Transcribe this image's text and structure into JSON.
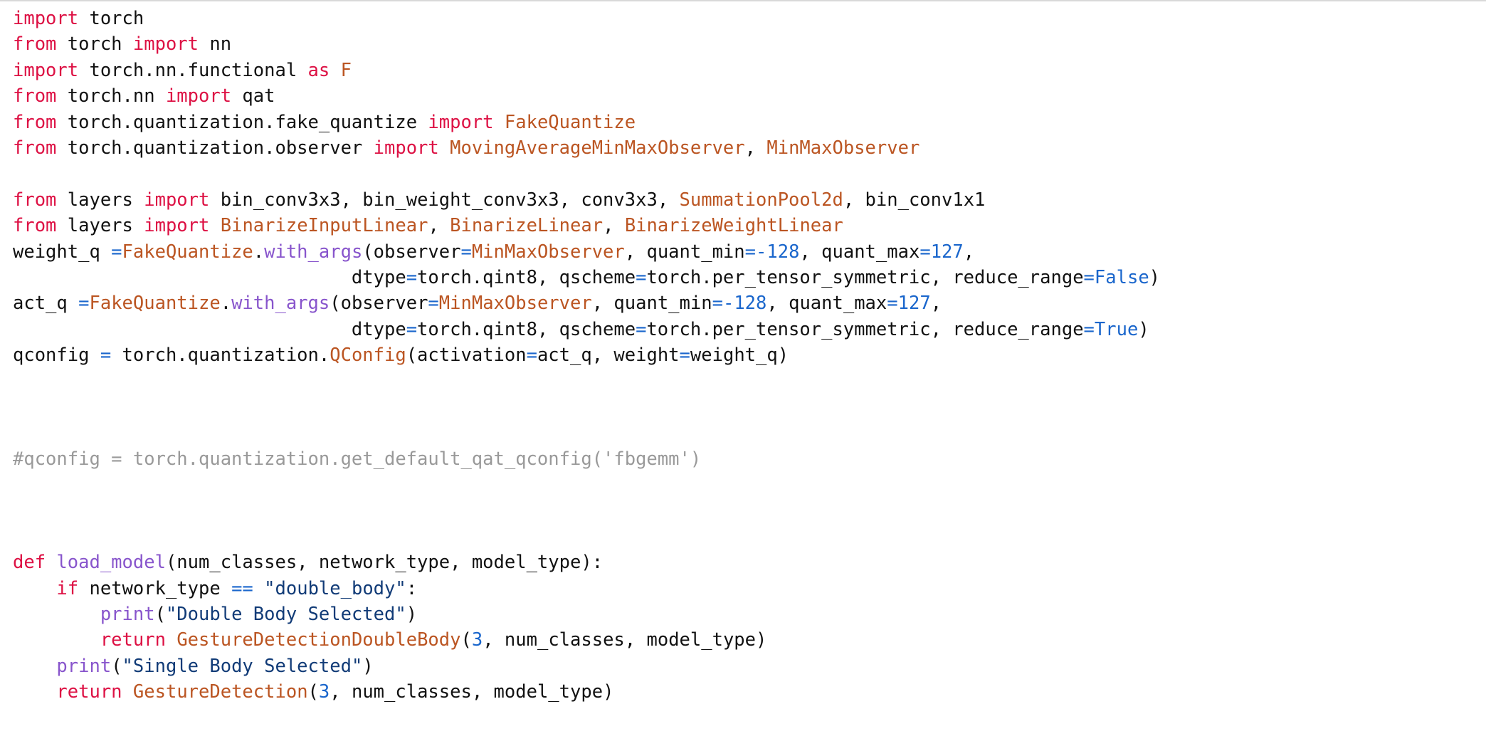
{
  "editor": {
    "language": "Python",
    "background_color": "#ffffff",
    "font_size_px": 25.5,
    "syntax_colors": {
      "keyword": "#dd1144",
      "class_name": "#bb5522",
      "function_name": "#8855cc",
      "number": "#1a66cc",
      "operator": "#1a66cc",
      "string": "#113b77",
      "comment": "#999999",
      "plain": "#111111"
    }
  },
  "code": {
    "lines": [
      {
        "index": 1,
        "text": "import torch",
        "tokens": [
          {
            "t": "import",
            "c": "kw"
          },
          {
            "t": " torch",
            "c": "pln"
          }
        ]
      },
      {
        "index": 2,
        "text": "from torch import nn",
        "tokens": [
          {
            "t": "from",
            "c": "kw"
          },
          {
            "t": " torch ",
            "c": "pln"
          },
          {
            "t": "import",
            "c": "kw"
          },
          {
            "t": " nn",
            "c": "pln"
          }
        ]
      },
      {
        "index": 3,
        "text": "import torch.nn.functional as F",
        "tokens": [
          {
            "t": "import",
            "c": "kw"
          },
          {
            "t": " torch.nn.functional ",
            "c": "pln"
          },
          {
            "t": "as",
            "c": "kw"
          },
          {
            "t": " ",
            "c": "pln"
          },
          {
            "t": "F",
            "c": "cls"
          }
        ]
      },
      {
        "index": 4,
        "text": "from torch.nn import qat",
        "tokens": [
          {
            "t": "from",
            "c": "kw"
          },
          {
            "t": " torch.nn ",
            "c": "pln"
          },
          {
            "t": "import",
            "c": "kw"
          },
          {
            "t": " qat",
            "c": "pln"
          }
        ]
      },
      {
        "index": 5,
        "text": "from torch.quantization.fake_quantize import FakeQuantize",
        "tokens": [
          {
            "t": "from",
            "c": "kw"
          },
          {
            "t": " torch.quantization.fake_quantize ",
            "c": "pln"
          },
          {
            "t": "import",
            "c": "kw"
          },
          {
            "t": " ",
            "c": "pln"
          },
          {
            "t": "FakeQuantize",
            "c": "cls"
          }
        ]
      },
      {
        "index": 6,
        "text": "from torch.quantization.observer import MovingAverageMinMaxObserver, MinMaxObserver",
        "tokens": [
          {
            "t": "from",
            "c": "kw"
          },
          {
            "t": " torch.quantization.observer ",
            "c": "pln"
          },
          {
            "t": "import",
            "c": "kw"
          },
          {
            "t": " ",
            "c": "pln"
          },
          {
            "t": "MovingAverageMinMaxObserver",
            "c": "cls"
          },
          {
            "t": ", ",
            "c": "pln"
          },
          {
            "t": "MinMaxObserver",
            "c": "cls"
          }
        ]
      },
      {
        "index": 7,
        "text": "",
        "tokens": []
      },
      {
        "index": 8,
        "text": "from layers import bin_conv3x3, bin_weight_conv3x3, conv3x3, SummationPool2d, bin_conv1x1",
        "tokens": [
          {
            "t": "from",
            "c": "kw"
          },
          {
            "t": " layers ",
            "c": "pln"
          },
          {
            "t": "import",
            "c": "kw"
          },
          {
            "t": " bin_conv3x3, bin_weight_conv3x3, conv3x3, ",
            "c": "pln"
          },
          {
            "t": "SummationPool2d",
            "c": "cls"
          },
          {
            "t": ", bin_conv1x1",
            "c": "pln"
          }
        ]
      },
      {
        "index": 9,
        "text": "from layers import BinarizeInputLinear, BinarizeLinear, BinarizeWeightLinear",
        "tokens": [
          {
            "t": "from",
            "c": "kw"
          },
          {
            "t": " layers ",
            "c": "pln"
          },
          {
            "t": "import",
            "c": "kw"
          },
          {
            "t": " ",
            "c": "pln"
          },
          {
            "t": "BinarizeInputLinear",
            "c": "cls"
          },
          {
            "t": ", ",
            "c": "pln"
          },
          {
            "t": "BinarizeLinear",
            "c": "cls"
          },
          {
            "t": ", ",
            "c": "pln"
          },
          {
            "t": "BinarizeWeightLinear",
            "c": "cls"
          }
        ]
      },
      {
        "index": 10,
        "text": "weight_q =FakeQuantize.with_args(observer=MinMaxObserver, quant_min=-128, quant_max=127,",
        "tokens": [
          {
            "t": "weight_q ",
            "c": "pln"
          },
          {
            "t": "=",
            "c": "op"
          },
          {
            "t": "FakeQuantize",
            "c": "cls"
          },
          {
            "t": ".",
            "c": "pln"
          },
          {
            "t": "with_args",
            "c": "fn"
          },
          {
            "t": "(observer",
            "c": "pln"
          },
          {
            "t": "=",
            "c": "op"
          },
          {
            "t": "MinMaxObserver",
            "c": "cls"
          },
          {
            "t": ", quant_min",
            "c": "pln"
          },
          {
            "t": "=",
            "c": "op"
          },
          {
            "t": "-128",
            "c": "num"
          },
          {
            "t": ", quant_max",
            "c": "pln"
          },
          {
            "t": "=",
            "c": "op"
          },
          {
            "t": "127",
            "c": "num"
          },
          {
            "t": ",",
            "c": "pln"
          }
        ]
      },
      {
        "index": 11,
        "text": "                               dtype=torch.qint8, qscheme=torch.per_tensor_symmetric, reduce_range=False)",
        "tokens": [
          {
            "t": "                               dtype",
            "c": "pln"
          },
          {
            "t": "=",
            "c": "op"
          },
          {
            "t": "torch.qint8, qscheme",
            "c": "pln"
          },
          {
            "t": "=",
            "c": "op"
          },
          {
            "t": "torch.per_tensor_symmetric, reduce_range",
            "c": "pln"
          },
          {
            "t": "=",
            "c": "op"
          },
          {
            "t": "False",
            "c": "num"
          },
          {
            "t": ")",
            "c": "pln"
          }
        ]
      },
      {
        "index": 12,
        "text": "act_q =FakeQuantize.with_args(observer=MinMaxObserver, quant_min=-128, quant_max=127,",
        "tokens": [
          {
            "t": "act_q ",
            "c": "pln"
          },
          {
            "t": "=",
            "c": "op"
          },
          {
            "t": "FakeQuantize",
            "c": "cls"
          },
          {
            "t": ".",
            "c": "pln"
          },
          {
            "t": "with_args",
            "c": "fn"
          },
          {
            "t": "(observer",
            "c": "pln"
          },
          {
            "t": "=",
            "c": "op"
          },
          {
            "t": "MinMaxObserver",
            "c": "cls"
          },
          {
            "t": ", quant_min",
            "c": "pln"
          },
          {
            "t": "=",
            "c": "op"
          },
          {
            "t": "-128",
            "c": "num"
          },
          {
            "t": ", quant_max",
            "c": "pln"
          },
          {
            "t": "=",
            "c": "op"
          },
          {
            "t": "127",
            "c": "num"
          },
          {
            "t": ",",
            "c": "pln"
          }
        ]
      },
      {
        "index": 13,
        "text": "                               dtype=torch.qint8, qscheme=torch.per_tensor_symmetric, reduce_range=True)",
        "tokens": [
          {
            "t": "                               dtype",
            "c": "pln"
          },
          {
            "t": "=",
            "c": "op"
          },
          {
            "t": "torch.qint8, qscheme",
            "c": "pln"
          },
          {
            "t": "=",
            "c": "op"
          },
          {
            "t": "torch.per_tensor_symmetric, reduce_range",
            "c": "pln"
          },
          {
            "t": "=",
            "c": "op"
          },
          {
            "t": "True",
            "c": "num"
          },
          {
            "t": ")",
            "c": "pln"
          }
        ]
      },
      {
        "index": 14,
        "text": "qconfig = torch.quantization.QConfig(activation=act_q, weight=weight_q)",
        "tokens": [
          {
            "t": "qconfig ",
            "c": "pln"
          },
          {
            "t": "=",
            "c": "op"
          },
          {
            "t": " torch.quantization.",
            "c": "pln"
          },
          {
            "t": "QConfig",
            "c": "cls"
          },
          {
            "t": "(activation",
            "c": "pln"
          },
          {
            "t": "=",
            "c": "op"
          },
          {
            "t": "act_q, weight",
            "c": "pln"
          },
          {
            "t": "=",
            "c": "op"
          },
          {
            "t": "weight_q)",
            "c": "pln"
          }
        ]
      },
      {
        "index": 15,
        "text": "",
        "tokens": []
      },
      {
        "index": 16,
        "text": "",
        "tokens": []
      },
      {
        "index": 17,
        "text": "",
        "tokens": []
      },
      {
        "index": 18,
        "text": "#qconfig = torch.quantization.get_default_qat_qconfig('fbgemm')",
        "tokens": [
          {
            "t": "#qconfig = torch.quantization.get_default_qat_qconfig('fbgemm')",
            "c": "cmt"
          }
        ]
      },
      {
        "index": 19,
        "text": "",
        "tokens": []
      },
      {
        "index": 20,
        "text": "",
        "tokens": []
      },
      {
        "index": 21,
        "text": "",
        "tokens": []
      },
      {
        "index": 22,
        "text": "def load_model(num_classes, network_type, model_type):",
        "tokens": [
          {
            "t": "def",
            "c": "kw"
          },
          {
            "t": " ",
            "c": "pln"
          },
          {
            "t": "load_model",
            "c": "fn"
          },
          {
            "t": "(num_classes, network_type, model_type):",
            "c": "pln"
          }
        ]
      },
      {
        "index": 23,
        "text": "    if network_type == \"double_body\":",
        "tokens": [
          {
            "t": "    ",
            "c": "pln"
          },
          {
            "t": "if",
            "c": "kw"
          },
          {
            "t": " network_type ",
            "c": "pln"
          },
          {
            "t": "==",
            "c": "op"
          },
          {
            "t": " ",
            "c": "pln"
          },
          {
            "t": "\"double_body\"",
            "c": "str"
          },
          {
            "t": ":",
            "c": "pln"
          }
        ]
      },
      {
        "index": 24,
        "text": "        print(\"Double Body Selected\")",
        "tokens": [
          {
            "t": "        ",
            "c": "pln"
          },
          {
            "t": "print",
            "c": "fn"
          },
          {
            "t": "(",
            "c": "pln"
          },
          {
            "t": "\"Double Body Selected\"",
            "c": "str"
          },
          {
            "t": ")",
            "c": "pln"
          }
        ]
      },
      {
        "index": 25,
        "text": "        return GestureDetectionDoubleBody(3, num_classes, model_type)",
        "tokens": [
          {
            "t": "        ",
            "c": "pln"
          },
          {
            "t": "return",
            "c": "kw"
          },
          {
            "t": " ",
            "c": "pln"
          },
          {
            "t": "GestureDetectionDoubleBody",
            "c": "cls"
          },
          {
            "t": "(",
            "c": "pln"
          },
          {
            "t": "3",
            "c": "num"
          },
          {
            "t": ", num_classes, model_type)",
            "c": "pln"
          }
        ]
      },
      {
        "index": 26,
        "text": "    print(\"Single Body Selected\")",
        "tokens": [
          {
            "t": "    ",
            "c": "pln"
          },
          {
            "t": "print",
            "c": "fn"
          },
          {
            "t": "(",
            "c": "pln"
          },
          {
            "t": "\"Single Body Selected\"",
            "c": "str"
          },
          {
            "t": ")",
            "c": "pln"
          }
        ]
      },
      {
        "index": 27,
        "text": "    return GestureDetection(3, num_classes, model_type)",
        "tokens": [
          {
            "t": "    ",
            "c": "pln"
          },
          {
            "t": "return",
            "c": "kw"
          },
          {
            "t": " ",
            "c": "pln"
          },
          {
            "t": "GestureDetection",
            "c": "cls"
          },
          {
            "t": "(",
            "c": "pln"
          },
          {
            "t": "3",
            "c": "num"
          },
          {
            "t": ", num_classes, model_type)",
            "c": "pln"
          }
        ]
      }
    ]
  }
}
